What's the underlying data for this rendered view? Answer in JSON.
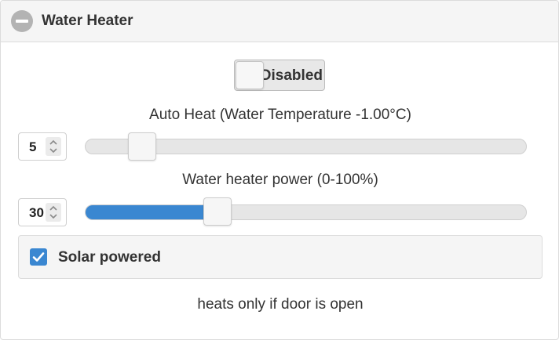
{
  "panel": {
    "title": "Water Heater"
  },
  "toggle": {
    "label": "Disabled",
    "state": "off"
  },
  "auto_heat": {
    "label": "Auto Heat (Water Temperature -1.00°C)",
    "value": "5",
    "slider_fraction": 0.13
  },
  "power": {
    "label": "Water heater power (0-100%)",
    "value": "30",
    "slider_fraction": 0.3,
    "fill_color": "#3a87d1"
  },
  "solar": {
    "label": "Solar powered",
    "checked": true,
    "accent_color": "#3a87d1"
  },
  "note": "heats only if door is open"
}
